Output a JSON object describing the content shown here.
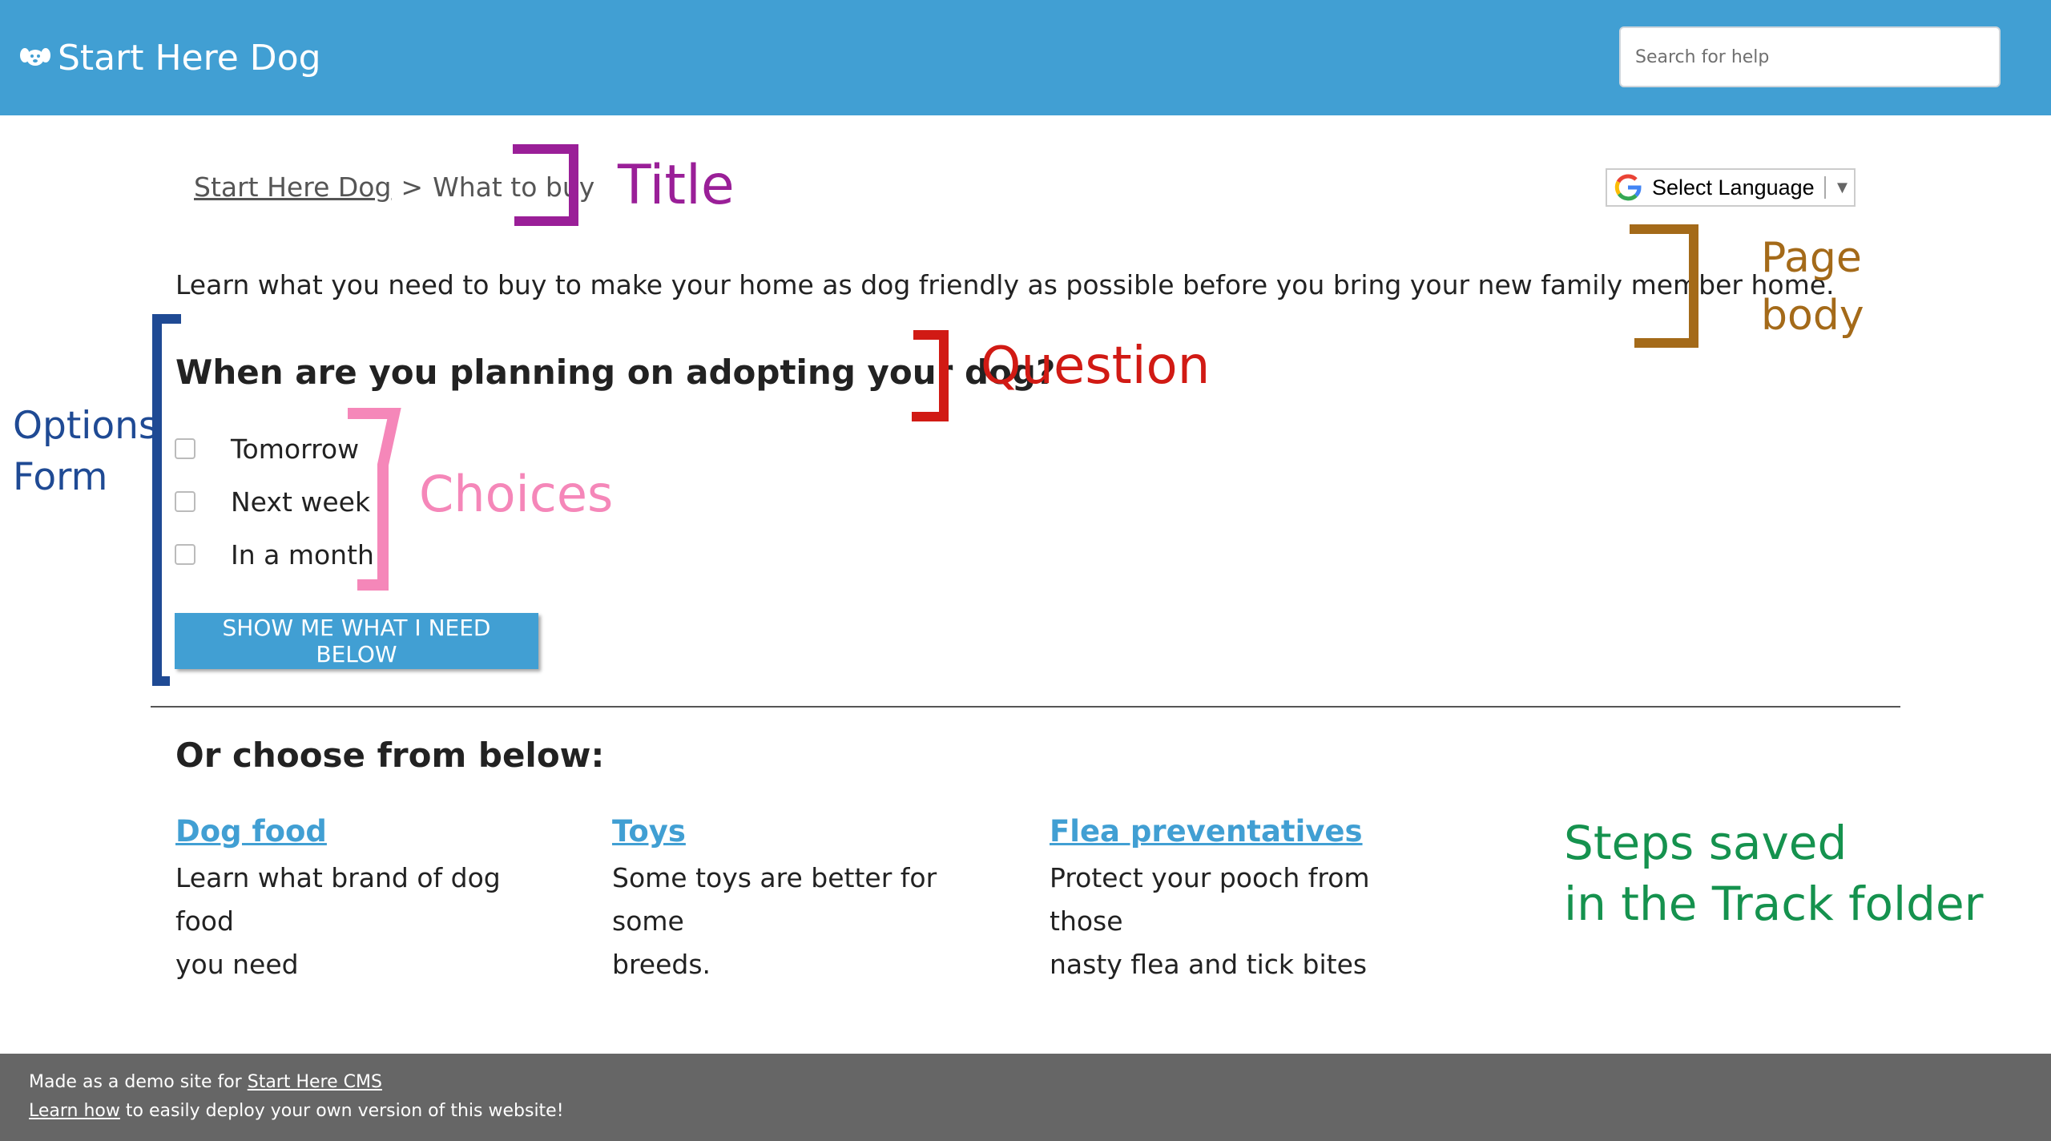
{
  "header": {
    "site_name": "Start Here Dog",
    "search_placeholder": "Search for help"
  },
  "breadcrumb": {
    "home": "Start Here Dog",
    "separator": ">",
    "current": "What to buy"
  },
  "language_selector": {
    "label": "Select Language",
    "arrow": "▼"
  },
  "intro": "Learn what you need to buy to make your home as dog friendly as possible before you bring your new family member home.",
  "form": {
    "question": "When are you planning on adopting your dog?",
    "choices": [
      "Tomorrow",
      "Next week",
      "In a month"
    ],
    "submit_label": "SHOW ME WHAT I NEED BELOW"
  },
  "choose_heading": "Or choose from below:",
  "cards": [
    {
      "title": "Dog food",
      "line1": "Learn what brand of dog food",
      "line2": "you need"
    },
    {
      "title": "Toys",
      "line1": "Some toys are better for some",
      "line2": "breeds."
    },
    {
      "title": "Flea preventatives",
      "line1": "Protect your pooch from those",
      "line2": "nasty flea and tick bites"
    }
  ],
  "annotations": {
    "title": "Title",
    "page_body_1": "Page",
    "page_body_2": "body",
    "question": "Question",
    "choices": "Choices",
    "options_1": "Options",
    "options_2": "Form",
    "steps_1": "Steps saved",
    "steps_2": "in the Track folder"
  },
  "footer": {
    "line1_prefix": "Made as a demo site for ",
    "line1_link": "Start Here CMS",
    "line2_link": "Learn how",
    "line2_suffix": " to easily deploy your own version of this website!"
  },
  "colors": {
    "brand_blue": "#419fd3",
    "footer_gray": "#666666",
    "title_annotation": "#9a1f98",
    "page_body_annotation": "#a46a19",
    "question_annotation": "#d11a14",
    "choices_annotation": "#f587b9",
    "options_annotation": "#1f4a94",
    "steps_annotation": "#15924e"
  },
  "icons": [
    "dog-logo-icon",
    "google-g-icon",
    "dropdown-arrow-icon",
    "checkbox-icon"
  ]
}
